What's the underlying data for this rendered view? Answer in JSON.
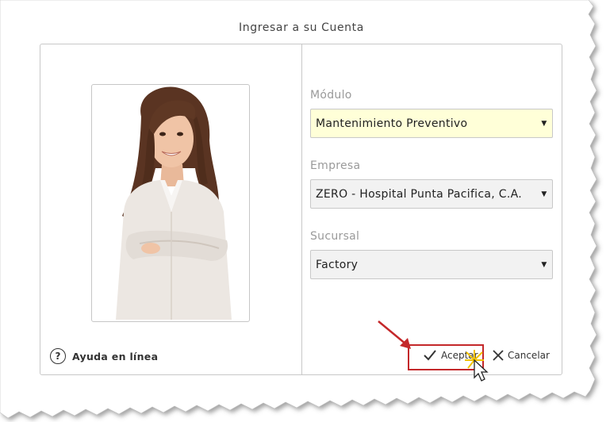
{
  "dialog": {
    "title": "Ingresar a su Cuenta"
  },
  "help": {
    "label": "Ayuda en línea",
    "icon": "question-circle-icon"
  },
  "fields": [
    {
      "label": "Módulo",
      "value": "Mantenimiento Preventivo",
      "highlighted": true
    },
    {
      "label": "Empresa",
      "value": "ZERO - Hospital Punta Pacifica, C.A.",
      "highlighted": false
    },
    {
      "label": "Sucursal",
      "value": "Factory",
      "highlighted": false
    }
  ],
  "buttons": {
    "accept_label": "Aceptar",
    "cancel_label": "Cancelar"
  },
  "colors": {
    "highlight_field": "#ffffd8",
    "annotation_red": "#c4282a",
    "field_bg": "#f2f2f2"
  }
}
